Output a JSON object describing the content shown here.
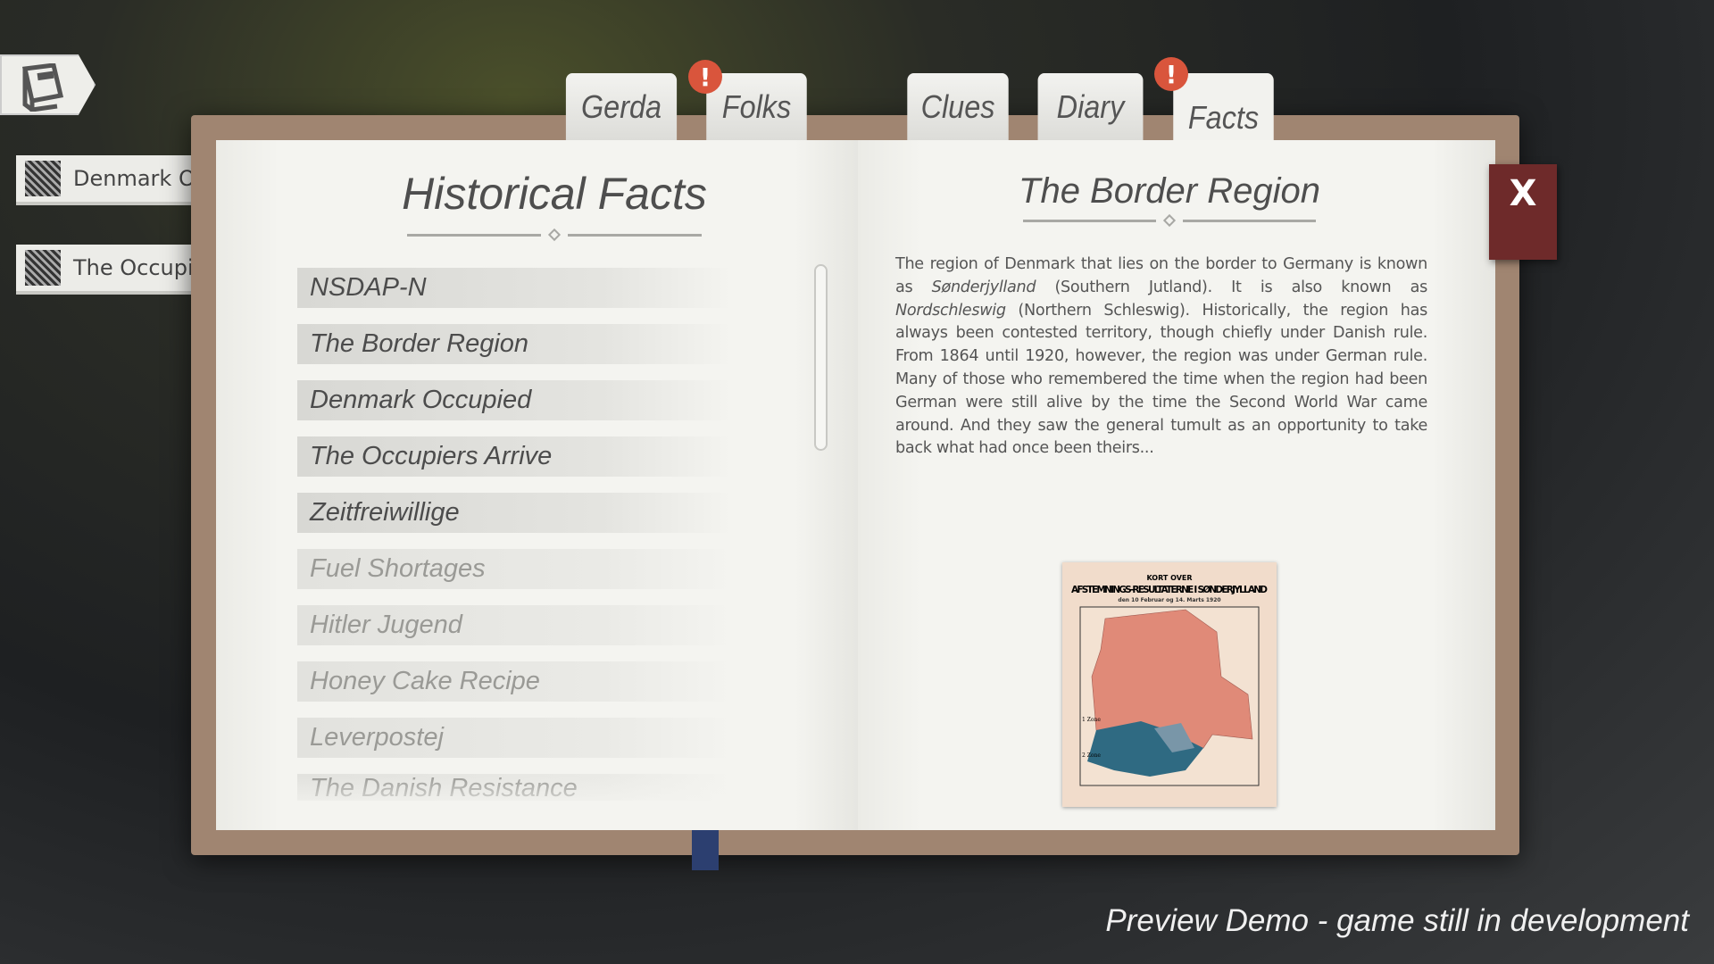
{
  "side": {
    "journal_icon": "book-icon",
    "tags": [
      {
        "label": "Denmark Occupied"
      },
      {
        "label": "The Occupiers Arrive"
      }
    ]
  },
  "tabs": [
    {
      "label": "Gerda"
    },
    {
      "label": "Folks",
      "alert": "!"
    },
    {
      "label": "Clues"
    },
    {
      "label": "Diary"
    },
    {
      "label": "Facts",
      "alert": "!",
      "active": true
    }
  ],
  "left": {
    "title": "Historical Facts",
    "items": [
      {
        "label": "NSDAP-N",
        "unlocked": true
      },
      {
        "label": "The Border Region",
        "unlocked": true
      },
      {
        "label": "Denmark Occupied",
        "unlocked": true
      },
      {
        "label": "The Occupiers Arrive",
        "unlocked": true
      },
      {
        "label": "Zeitfreiwillige",
        "unlocked": true
      },
      {
        "label": "Fuel Shortages",
        "unlocked": false
      },
      {
        "label": "Hitler Jugend",
        "unlocked": false
      },
      {
        "label": "Honey Cake Recipe",
        "unlocked": false
      },
      {
        "label": "Leverpostej",
        "unlocked": false
      },
      {
        "label": "The Danish Resistance",
        "unlocked": false
      }
    ]
  },
  "right": {
    "title": "The Border Region",
    "body": [
      {
        "t": "The region of Denmark that lies on the border to Germany is known as "
      },
      {
        "t": "Sønderjylland",
        "i": true
      },
      {
        "t": " (Southern Jutland). It is also known as "
      },
      {
        "t": "Nordschleswig",
        "i": true
      },
      {
        "t": " (Northern Schleswig). Historically, the region has always been contested territory, though chiefly under Danish rule. From 1864 until 1920, however, the region was under German rule. Many of those who remembered the time when the region had been German were still alive by the time the Second World War came around. And they saw the general tumult as an opportunity to take back what had once been theirs..."
      }
    ],
    "image": {
      "line1": "KORT OVER",
      "line2": "AFSTEMNINGS-RESULTATERNE I SØNDERJYLLAND",
      "line3": "den 10 Februar og 14. Marts 1920",
      "zone1": "1 Zone",
      "zone2": "2 Zone"
    }
  },
  "close_label": "X",
  "footer": "Preview Demo - game still in development",
  "colors": {
    "alert": "#d9553c",
    "close": "#6e2a2a",
    "map_danish": "#e08a78",
    "map_german": "#2f6a82"
  }
}
